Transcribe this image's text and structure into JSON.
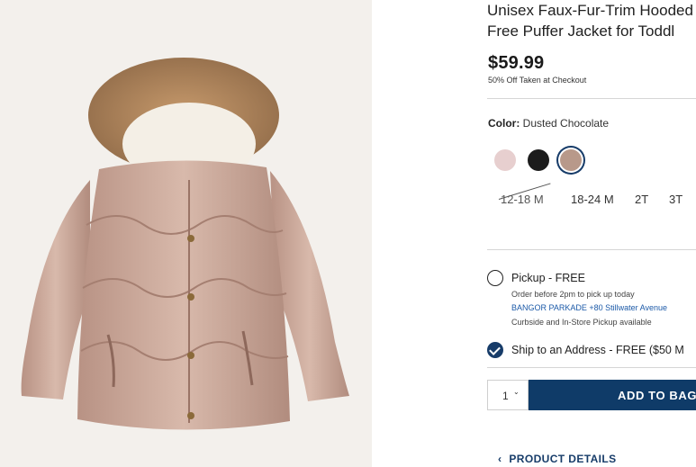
{
  "product": {
    "title_line1": "Unisex Faux-Fur-Trim Hooded",
    "title_line2": "Free Puffer Jacket for Toddl",
    "price": "$59.99",
    "promo": "50% Off Taken at Checkout",
    "image_alt": "Dusted chocolate puffer jacket with faux-fur hood"
  },
  "color": {
    "label": "Color:",
    "selected": "Dusted Chocolate",
    "swatches": [
      {
        "name": "pink",
        "hex": "#e7cfcf",
        "selected": false
      },
      {
        "name": "black",
        "hex": "#1c1c1c",
        "selected": false
      },
      {
        "name": "dusted-chocolate",
        "hex": "#b8998a",
        "selected": true
      }
    ]
  },
  "sizes": [
    {
      "label": "12-18 M",
      "available": false
    },
    {
      "label": "18-24 M",
      "available": true
    },
    {
      "label": "2T",
      "available": true
    },
    {
      "label": "3T",
      "available": true
    }
  ],
  "fulfillment": {
    "pickup": {
      "label": "Pickup - FREE",
      "deadline": "Order before 2pm to pick up today",
      "store": "BANGOR PARKADE +80 Stillwater Avenue",
      "note": "Curbside and In-Store Pickup available",
      "checked": false
    },
    "ship": {
      "label": "Ship to an Address - FREE ($50 M",
      "checked": true
    }
  },
  "cart": {
    "quantity": "1",
    "add_label": "ADD TO BAG"
  },
  "details": {
    "label": "PRODUCT DETAILS"
  },
  "colors": {
    "navy": "#0f3b68",
    "link": "#1c5aa8",
    "divider": "#d6d6d6"
  }
}
